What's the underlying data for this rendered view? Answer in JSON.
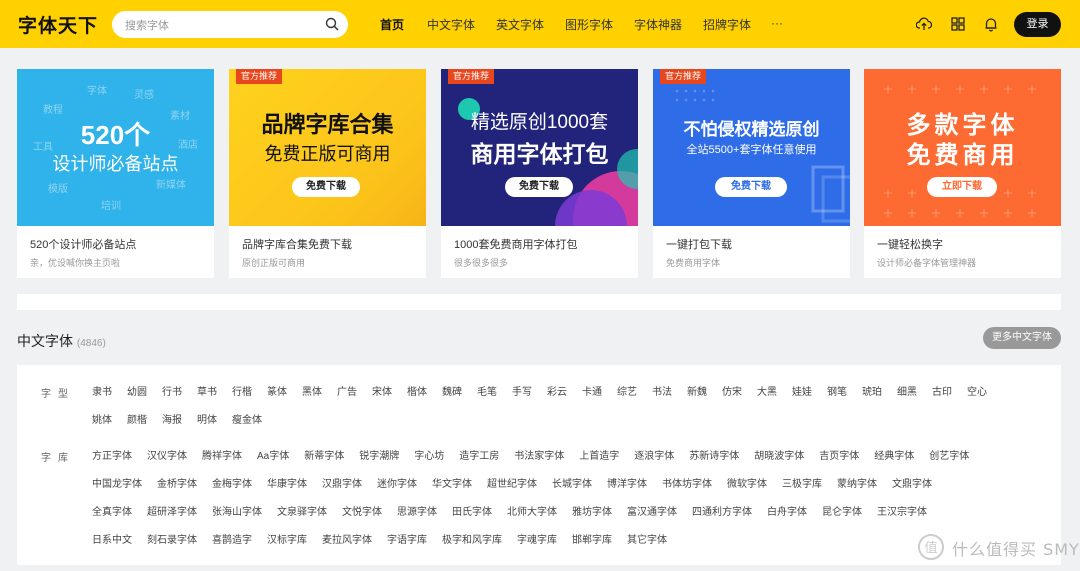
{
  "header": {
    "logo": "字体天下",
    "search_placeholder": "搜索字体",
    "nav": [
      "首页",
      "中文字体",
      "英文字体",
      "图形字体",
      "字体神器",
      "招牌字体",
      "···"
    ],
    "login": "登录"
  },
  "cards": [
    {
      "badge": "",
      "banner_line1": "520个",
      "banner_line2": "设计师必备站点",
      "banner_button": "",
      "title": "520个设计师必备站点",
      "sub": "亲，优设喊你换主页啦"
    },
    {
      "badge": "官方推荐",
      "banner_line1": "品牌字库合集",
      "banner_line2": "免费正版可商用",
      "banner_button": "免费下载",
      "title": "品牌字库合集免费下载",
      "sub": "原创正版可商用"
    },
    {
      "badge": "官方推荐",
      "banner_line1": "精选原创1000套",
      "banner_line2": "商用字体打包",
      "banner_button": "免费下载",
      "title": "1000套免费商用字体打包",
      "sub": "很多很多很多"
    },
    {
      "badge": "官方推荐",
      "banner_line1": "不怕侵权精选原创",
      "banner_line2": "全站5500+套字体任意使用",
      "banner_button": "免费下载",
      "title": "一键打包下载",
      "sub": "免费商用字体"
    },
    {
      "badge": "",
      "banner_line1": "多款字体",
      "banner_line2": "免费商用",
      "banner_button": "立即下载",
      "title": "一键轻松换字",
      "sub": "设计师必备字体管理神器"
    }
  ],
  "card1_words": [
    "字体",
    "灵感",
    "教程",
    "素材",
    "工具",
    "酒店",
    "模版",
    "新媒体",
    "培训"
  ],
  "section": {
    "title": "中文字体",
    "count": "(4846)",
    "more": "更多中文字体"
  },
  "types": {
    "label": "字型",
    "line1": [
      "隶书",
      "幼圆",
      "行书",
      "草书",
      "行楷",
      "篆体",
      "黑体",
      "广告",
      "宋体",
      "楷体",
      "魏碑",
      "毛笔",
      "手写",
      "彩云",
      "卡通",
      "综艺",
      "书法",
      "新魏",
      "仿宋",
      "大黑",
      "娃娃",
      "钢笔",
      "琥珀",
      "细黑",
      "古印",
      "空心"
    ],
    "line2": [
      "姚体",
      "颜楷",
      "海报",
      "明体",
      "瘦金体"
    ]
  },
  "libraries": {
    "label": "字库",
    "line1": [
      "方正字体",
      "汉仪字体",
      "腾祥字体",
      "Aa字体",
      "新蒂字体",
      "锐字潮牌",
      "字心坊",
      "造字工房",
      "书法家字体",
      "上首造字",
      "逐浪字体",
      "苏新诗字体",
      "胡晓波字体",
      "吉页字体",
      "经典字体",
      "创艺字体"
    ],
    "line2": [
      "中国龙字体",
      "金桥字体",
      "金梅字体",
      "华康字体",
      "汉鼎字体",
      "迷你字体",
      "华文字体",
      "超世纪字体",
      "长城字体",
      "博洋字体",
      "书体坊字体",
      "微软字体",
      "三极字库",
      "蒙纳字体",
      "文鼎字体"
    ],
    "line3": [
      "全真字体",
      "超研泽字体",
      "张海山字体",
      "文泉驿字体",
      "文悦字体",
      "思源字体",
      "田氏字体",
      "北师大字体",
      "雅坊字体",
      "富汉通字体",
      "四通利方字体",
      "白舟字体",
      "昆仑字体",
      "王汉宗字体"
    ],
    "line4": [
      "日系中文",
      "刻石录字体",
      "喜鹊造字",
      "汉标字库",
      "麦拉风字体",
      "字语字库",
      "极字和风字库",
      "字魂字库",
      "邯郸字库",
      "其它字体"
    ]
  },
  "watermark": "什么值得买 SMYZ.NET"
}
